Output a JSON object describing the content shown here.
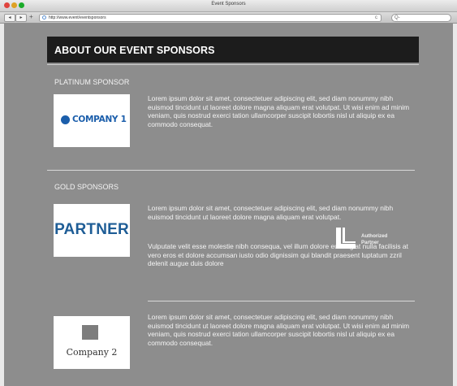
{
  "window": {
    "title": "Event Sponsors",
    "url": "http://www.event/eventsponsors",
    "search_placeholder": "Q-"
  },
  "toolbar": {
    "back_label": "◂",
    "forward_label": "▸",
    "add_label": "+",
    "reload_label": "c"
  },
  "page": {
    "heading": "ABOUT OUR EVENT SPONSORS",
    "platinum": {
      "heading": "PLATINUM SPONSOR",
      "logo_text": "COMPANY 1",
      "description": "Lorem ipsum dolor sit amet, consectetuer adipiscing elit, sed diam nonummy nibh euismod tincidunt ut laoreet dolore magna aliquam erat volutpat. Ut wisi enim ad minim veniam, quis nostrud exerci tation ullamcorper suscipit lobortis nisl ut aliquip ex ea commodo consequat."
    },
    "gold": {
      "heading": "GOLD SPONSORS",
      "partner": {
        "logo_text": "PARTNER",
        "description_1": "Lorem ipsum dolor sit amet, consectetuer adipiscing elit, sed diam nonummy nibh euismod tincidunt ut laoreet dolore magna aliquam erat volutpat.",
        "description_2": "Vulputate velit esse molestie nibh consequa, vel illum dolore eu feugiat nulla facilisis at vero eros et dolore accumsan iusto odio dignissim qui blandit praesent luptatum zzril delenit augue duis dolore",
        "badge_line1": "Authorized",
        "badge_line2": "Partner"
      },
      "company2": {
        "logo_text": "Company 2",
        "description": "Lorem ipsum dolor sit amet, consectetuer adipiscing elit, sed diam nonummy nibh euismod tincidunt ut laoreet dolore magna aliquam erat volutpat. Ut wisi enim ad minim veniam, quis nostrud exerci tation ullamcorper suscipit lobortis nisl ut aliquip ex ea commodo consequat."
      }
    }
  },
  "colors": {
    "page_background": "#8d8d8d",
    "header_background": "#1c1c1c",
    "logo_blue": "#1b5eab",
    "partner_blue": "#1e5d96"
  }
}
